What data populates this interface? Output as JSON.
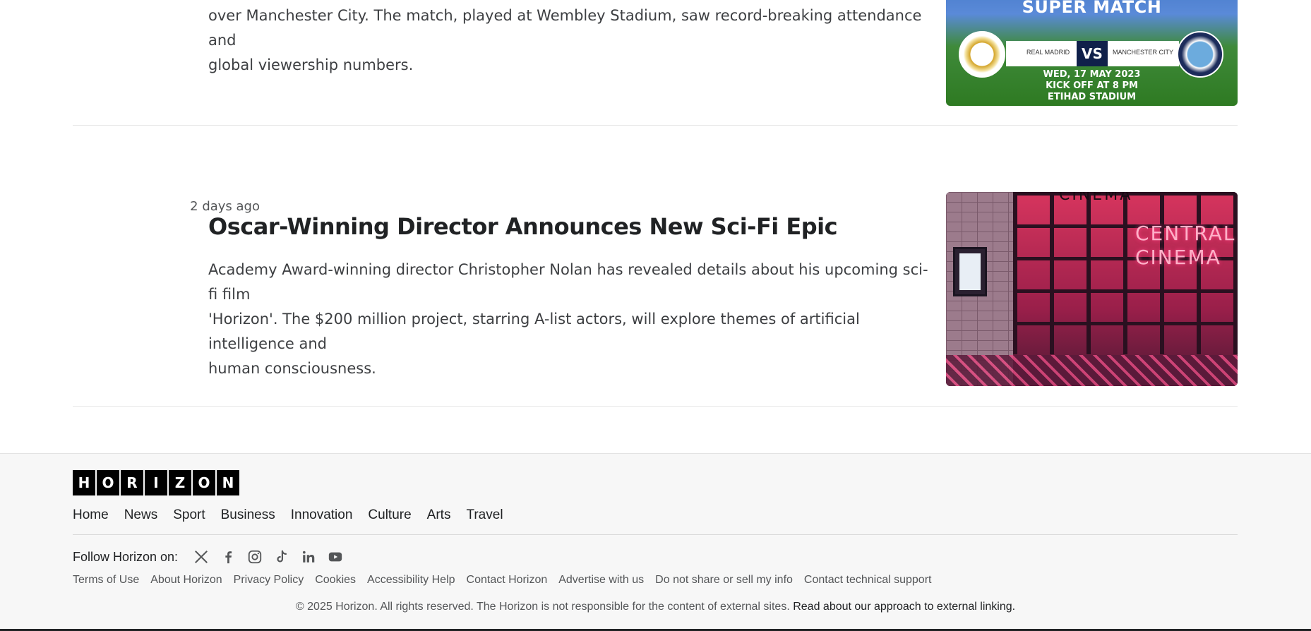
{
  "articles": [
    {
      "summary_line_1": "over Manchester City. The match, played at Wembley Stadium, saw record-breaking attendance and",
      "summary_line_2": "global viewership numbers.",
      "image": {
        "title": "SUPER MATCH",
        "team_left": "REAL MADRID",
        "vs": "VS",
        "team_right": "MANCHESTER CITY",
        "date_line_1": "WED, 17 MAY 2023",
        "date_line_2": "KICK OFF AT 8 PM",
        "date_line_3": "ETIHAD STADIUM"
      }
    },
    {
      "time": "2 days ago",
      "headline": "Oscar-Winning Director Announces New Sci-Fi Epic",
      "summary_line_1": "Academy Award-winning director Christopher Nolan has revealed details about his upcoming sci-fi film",
      "summary_line_2": "'Horizon'. The $200 million project, starring A-list actors, will explore themes of artificial intelligence and",
      "summary_line_3": "human consciousness.",
      "image": {
        "sign_top": "CINEMA",
        "neon_line_1": "CENTRAL",
        "neon_line_2": "CINEMA"
      }
    }
  ],
  "footer": {
    "logo_letters": [
      "H",
      "O",
      "R",
      "I",
      "Z",
      "O",
      "N"
    ],
    "nav": [
      "Home",
      "News",
      "Sport",
      "Business",
      "Innovation",
      "Culture",
      "Arts",
      "Travel"
    ],
    "follow_label": "Follow Horizon on:",
    "social_icons": [
      "x-icon",
      "facebook-icon",
      "instagram-icon",
      "tiktok-icon",
      "linkedin-icon",
      "youtube-icon"
    ],
    "legal_links": [
      "Terms of Use",
      "About Horizon",
      "Privacy Policy",
      "Cookies",
      "Accessibility Help",
      "Contact Horizon",
      "Advertise with us",
      "Do not share or sell my info",
      "Contact technical support"
    ],
    "copyright": "© 2025 Horizon. All rights reserved. The Horizon is not responsible for the content of external sites.",
    "external_link": "Read about our approach to external linking."
  },
  "colors": {
    "text": "#202224",
    "muted": "#545658",
    "footer_bg": "#f7f7f7",
    "logo_bg": "#000000"
  }
}
